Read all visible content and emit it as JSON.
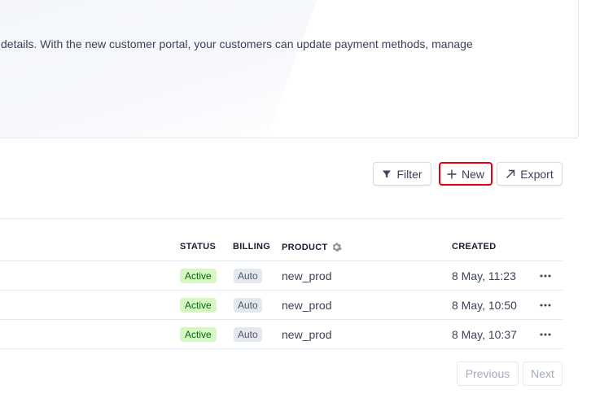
{
  "banner": {
    "text": "details. With the new customer portal, your customers can update payment methods, manage"
  },
  "toolbar": {
    "filter_label": "Filter",
    "new_label": "New",
    "export_label": "Export",
    "highlight_color": "#e3000f"
  },
  "table": {
    "columns": {
      "status": "STATUS",
      "billing": "BILLING",
      "product": "PRODUCT",
      "created": "CREATED"
    },
    "rows": [
      {
        "status": "Active",
        "billing": "Auto",
        "product": "new_prod",
        "created": "8 May, 11:23"
      },
      {
        "status": "Active",
        "billing": "Auto",
        "product": "new_prod",
        "created": "8 May, 10:50"
      },
      {
        "status": "Active",
        "billing": "Auto",
        "product": "new_prod",
        "created": "8 May, 10:37"
      }
    ]
  },
  "pagination": {
    "previous_label": "Previous",
    "next_label": "Next"
  },
  "icons": {
    "filter": "filter-icon",
    "new": "plus-icon",
    "export": "arrow-up-right-icon",
    "product_settings": "gear-icon",
    "row_menu": "more-horizontal-icon"
  },
  "colors": {
    "active_badge_bg": "#d7f7c2",
    "active_badge_text": "#05690d",
    "auto_badge_bg": "#e3e8ee"
  }
}
